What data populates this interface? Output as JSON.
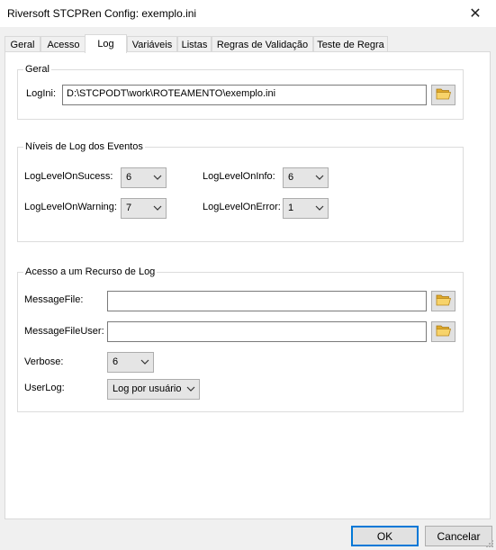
{
  "window": {
    "title": "Riversoft STCPRen Config: exemplo.ini",
    "close_glyph": "✕"
  },
  "tabs": [
    {
      "label": "Geral"
    },
    {
      "label": "Acesso"
    },
    {
      "label": "Log"
    },
    {
      "label": "Variáveis"
    },
    {
      "label": "Listas"
    },
    {
      "label": "Regras de Validação"
    },
    {
      "label": "Teste de Regra"
    }
  ],
  "active_tab": "Log",
  "geral": {
    "legend": "Geral",
    "logini_label": "LogIni:",
    "logini_value": "D:\\STCPODT\\work\\ROTEAMENTO\\exemplo.ini",
    "browse_icon": "folder-open-icon"
  },
  "niveis": {
    "legend": "Níveis de Log dos Eventos",
    "sucess_label": "LogLevelOnSucess:",
    "sucess_value": "6",
    "warning_label": "LogLevelOnWarning:",
    "warning_value": "7",
    "info_label": "LogLevelOnInfo:",
    "info_value": "6",
    "error_label": "LogLevelOnError:",
    "error_value": "1"
  },
  "acesso": {
    "legend": "Acesso a um Recurso de Log",
    "messagefile_label": "MessageFile:",
    "messagefile_value": "",
    "messagefileuser_label": "MessageFileUser:",
    "messagefileuser_value": "",
    "verbose_label": "Verbose:",
    "verbose_value": "6",
    "userlog_label": "UserLog:",
    "userlog_value": "Log por usuário"
  },
  "buttons": {
    "ok": "OK",
    "cancel": "Cancelar"
  },
  "colors": {
    "accent": "#0078d7",
    "folder": "#f2c94c"
  }
}
